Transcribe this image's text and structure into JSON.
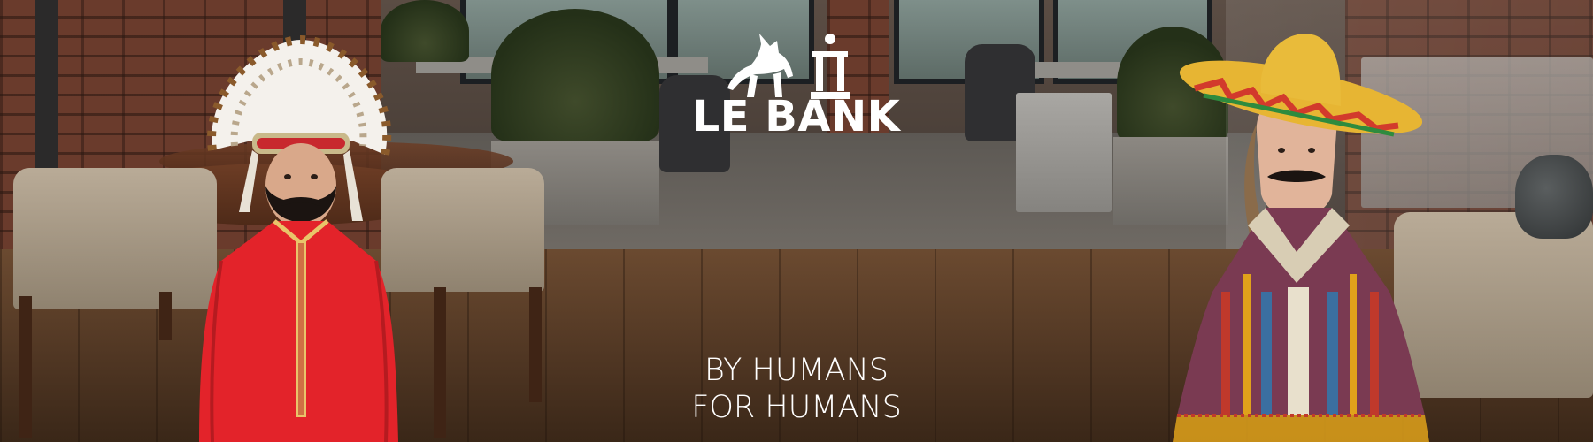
{
  "banner": {
    "logo_text": "LE BANK",
    "tagline_line1": "BY HUMANS",
    "tagline_line2": "FOR HUMANS"
  },
  "colors": {
    "text": "#ffffff",
    "shirt_red": "#e3232a",
    "floor_wood": "#5a3e28",
    "poncho_stripe": "#c0392b"
  },
  "icons": {
    "logo_mark": "donkey-with-pillar-icon"
  }
}
